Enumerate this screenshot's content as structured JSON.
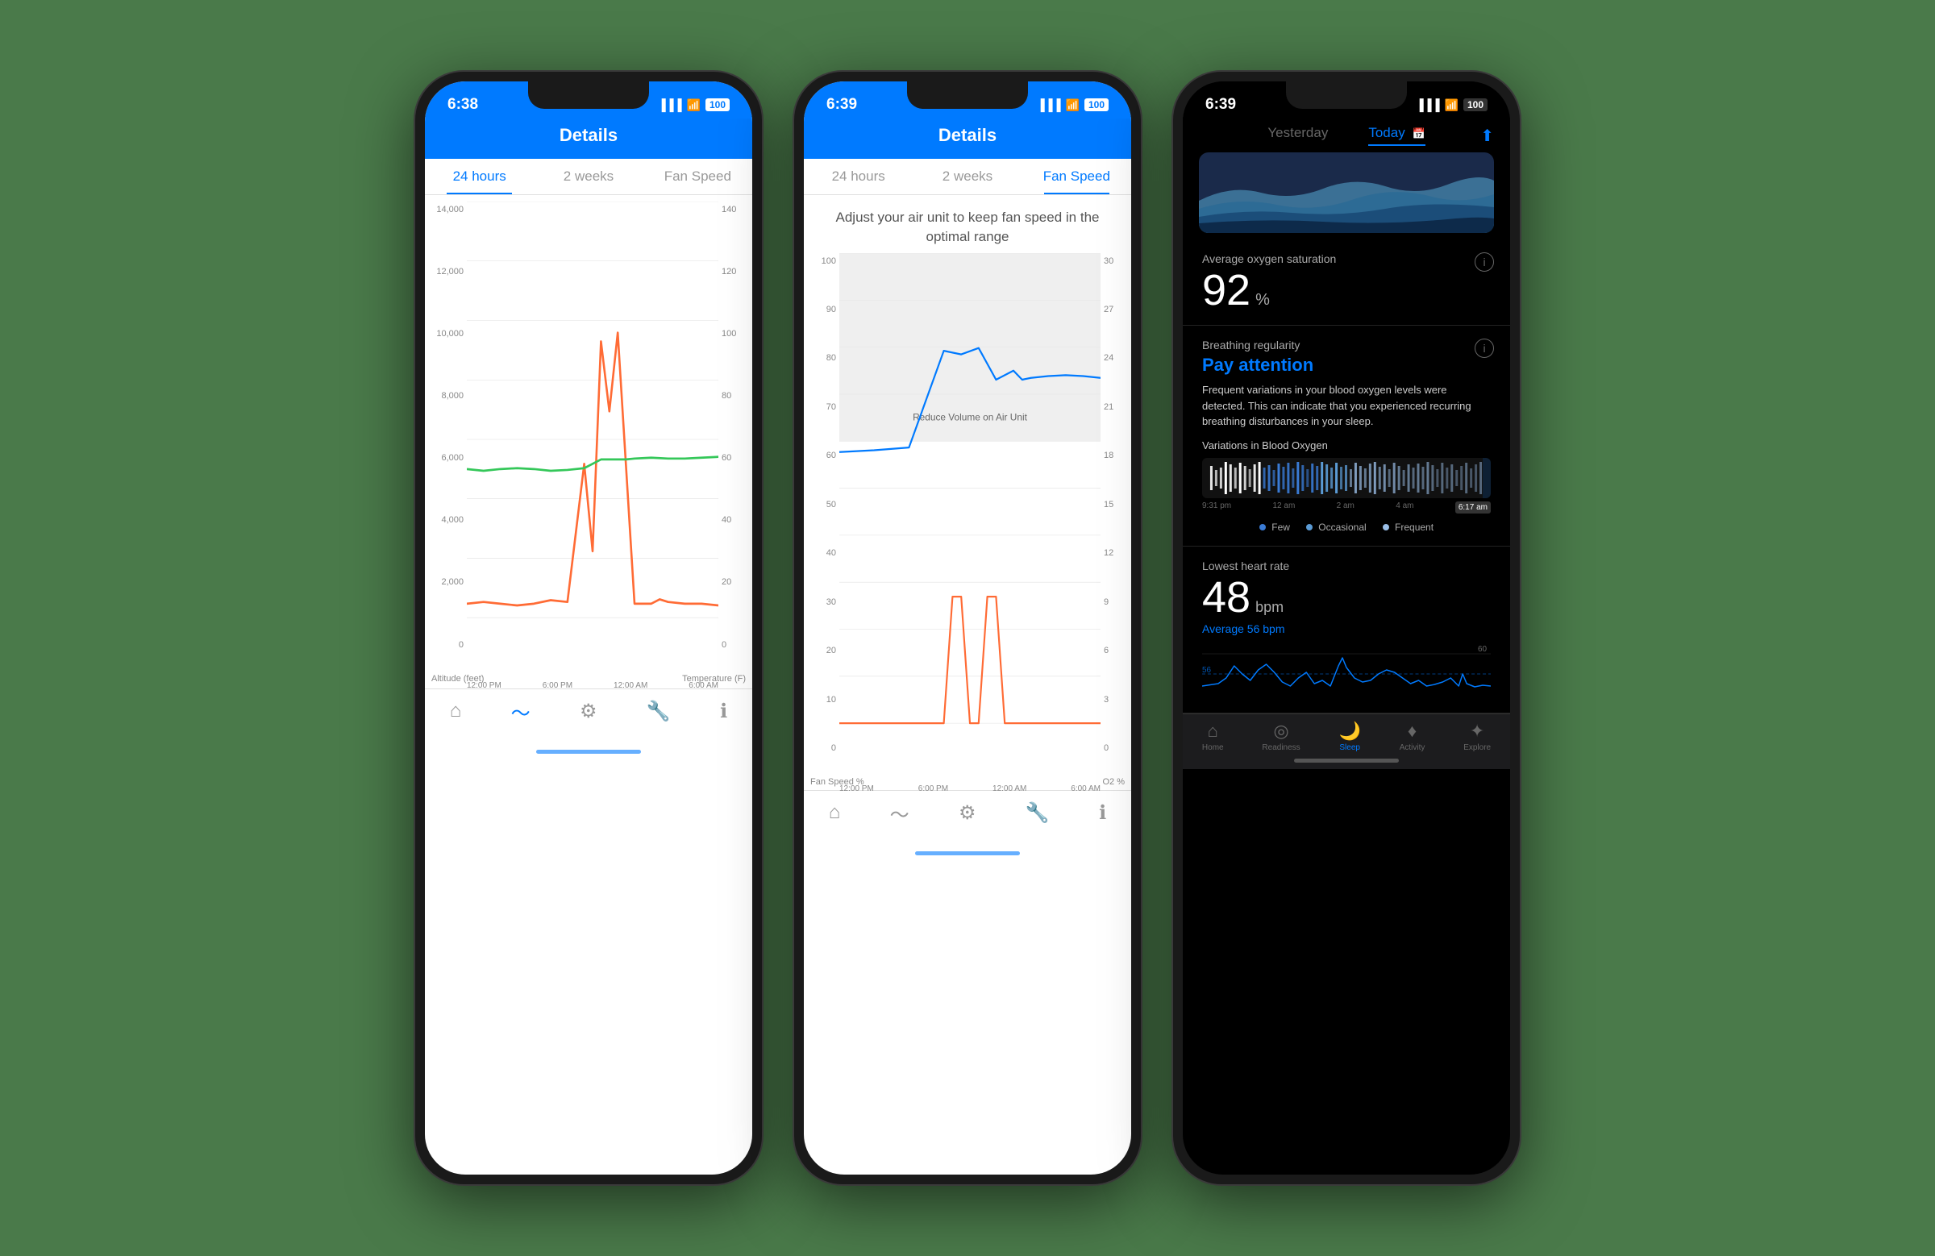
{
  "phone1": {
    "statusBar": {
      "time": "6:38",
      "locationIcon": "▲",
      "signal": "▐▐▐",
      "wifi": "WiFi",
      "battery": "100"
    },
    "header": {
      "title": "Details"
    },
    "tabs": [
      {
        "label": "24 hours",
        "active": true
      },
      {
        "label": "2 weeks",
        "active": false
      },
      {
        "label": "Fan Speed",
        "active": false
      }
    ],
    "chart": {
      "yLeftLabel": "Altitude (feet)",
      "yRightLabel": "Temperature (F)",
      "xLabels": [
        "12:00 PM",
        "6:00 PM",
        "12:00 AM",
        "6:00 AM"
      ],
      "yLeftTicks": [
        "14,000",
        "12,000",
        "10,000",
        "8,000",
        "6,000",
        "4,000",
        "2,000",
        "0"
      ],
      "yRightTicks": [
        "140",
        "120",
        "100",
        "80",
        "60",
        "40",
        "20",
        "0"
      ]
    },
    "bottomNav": [
      {
        "icon": "⌂",
        "label": "Home"
      },
      {
        "icon": "∿",
        "label": "Activity"
      },
      {
        "icon": "⚙",
        "label": "Settings"
      },
      {
        "icon": "🔧",
        "label": "Tools"
      },
      {
        "icon": "ℹ",
        "label": "Info"
      }
    ]
  },
  "phone2": {
    "statusBar": {
      "time": "6:39",
      "locationIcon": "▲",
      "signal": "▐▐▐",
      "wifi": "WiFi",
      "battery": "100"
    },
    "header": {
      "title": "Details"
    },
    "tabs": [
      {
        "label": "24 hours",
        "active": false
      },
      {
        "label": "2 weeks",
        "active": false
      },
      {
        "label": "Fan Speed",
        "active": true
      }
    ],
    "fanSpeedInfo": "Adjust your air unit to keep fan speed\nin the optimal range",
    "alertLabel": "Reduce Volume on Air Unit",
    "chart": {
      "yLeftLabel": "Fan Speed %",
      "yRightLabel": "O2 %",
      "xLabels": [
        "12:00 PM",
        "6:00 PM",
        "12:00 AM",
        "6:00 AM"
      ],
      "yLeftTicks": [
        "100",
        "90",
        "80",
        "70",
        "60",
        "50",
        "40",
        "30",
        "20",
        "10",
        "0"
      ],
      "yRightTicks": [
        "30",
        "27",
        "24",
        "21",
        "18",
        "15",
        "12",
        "9",
        "6",
        "3",
        "0"
      ]
    },
    "bottomNav": [
      {
        "icon": "⌂",
        "label": "Home"
      },
      {
        "icon": "∿",
        "label": "Activity"
      },
      {
        "icon": "⚙",
        "label": "Settings"
      },
      {
        "icon": "🔧",
        "label": "Tools"
      },
      {
        "icon": "ℹ",
        "label": "Info"
      }
    ]
  },
  "phone3": {
    "statusBar": {
      "time": "6:39",
      "locationIcon": "▲",
      "signal": "▐▐▐",
      "wifi": "WiFi",
      "battery": "100"
    },
    "tabs": [
      {
        "label": "Yesterday",
        "active": false
      },
      {
        "label": "Today",
        "active": true
      }
    ],
    "oxygenSection": {
      "label": "Average oxygen saturation",
      "value": "92",
      "unit": "%"
    },
    "breathingSection": {
      "label": "Breathing regularity",
      "status": "Pay attention",
      "description": "Frequent variations in your blood oxygen levels were detected. This can indicate that you experienced recurring breathing disturbances in your sleep.",
      "subLabel": "Variations in Blood Oxygen"
    },
    "timeLabels": [
      "9:31 pm",
      "12 am",
      "2 am",
      "4 am",
      "6:17 am"
    ],
    "legend": [
      {
        "color": "#3a7bd5",
        "label": "Few"
      },
      {
        "color": "#5b9bd5",
        "label": "Occasional"
      },
      {
        "color": "#9bbfe8",
        "label": "Frequent"
      }
    ],
    "heartSection": {
      "label": "Lowest heart rate",
      "value": "48",
      "unit": "bpm",
      "avgLabel": "Average 56 bpm"
    },
    "heartChartYLabel": "60",
    "heartChartAvgLabel": "56",
    "bottomNav": [
      {
        "icon": "⌂",
        "label": "Home",
        "active": false
      },
      {
        "icon": "◎",
        "label": "Readiness",
        "active": false
      },
      {
        "icon": "🌙",
        "label": "Sleep",
        "active": true
      },
      {
        "icon": "♦",
        "label": "Activity",
        "active": false
      },
      {
        "icon": "✦",
        "label": "Explore",
        "active": false
      }
    ]
  }
}
